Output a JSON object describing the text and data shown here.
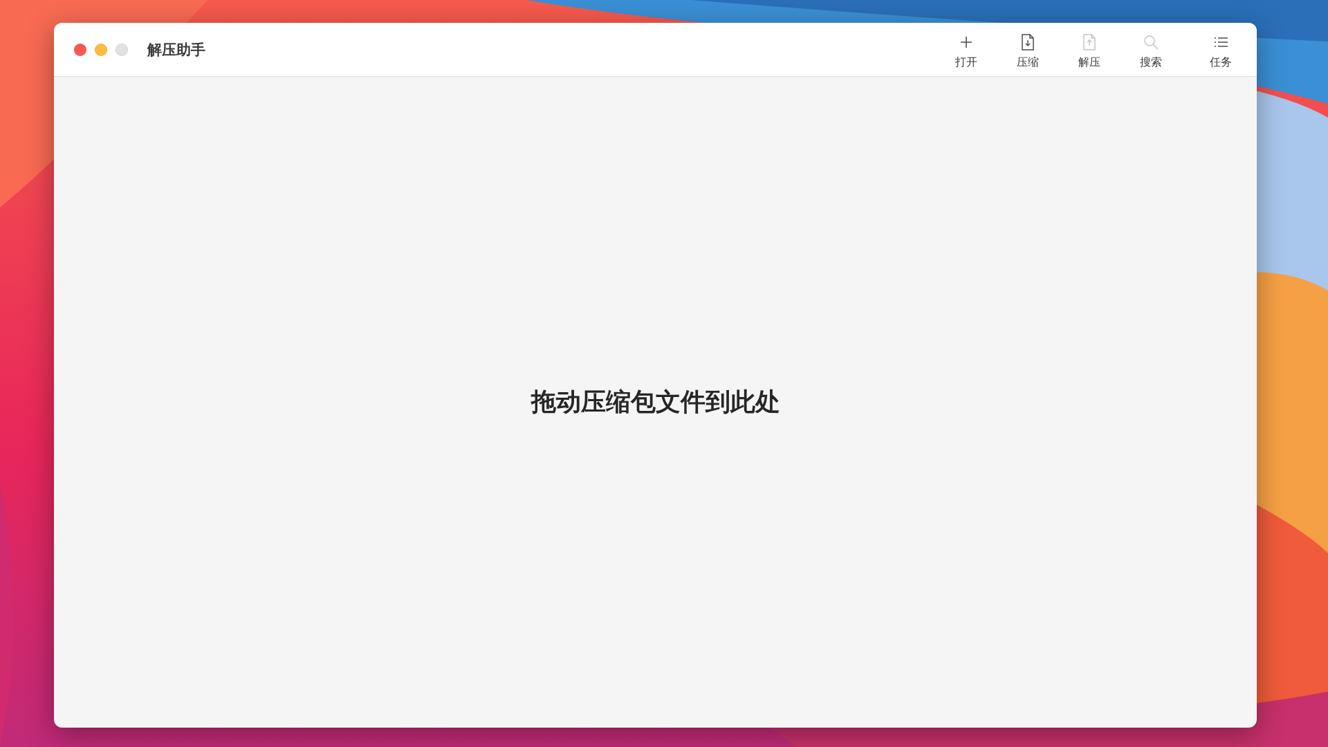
{
  "window": {
    "title": "解压助手",
    "controls": [
      {
        "color": "#fc5753"
      },
      {
        "color": "#fdbc40"
      },
      {
        "color": "#e2e2e2"
      }
    ]
  },
  "toolbar": [
    {
      "kind": "add",
      "label": "打开",
      "disabled": false
    },
    {
      "kind": "compress",
      "label": "压缩",
      "disabled": false
    },
    {
      "kind": "extract",
      "label": "解压",
      "disabled": true
    },
    {
      "kind": "search",
      "label": "搜索",
      "disabled": true
    },
    {
      "kind": "tasks",
      "label": "任务",
      "disabled": false
    }
  ],
  "drop_zone": {
    "message": "拖动压缩包文件到此处"
  }
}
